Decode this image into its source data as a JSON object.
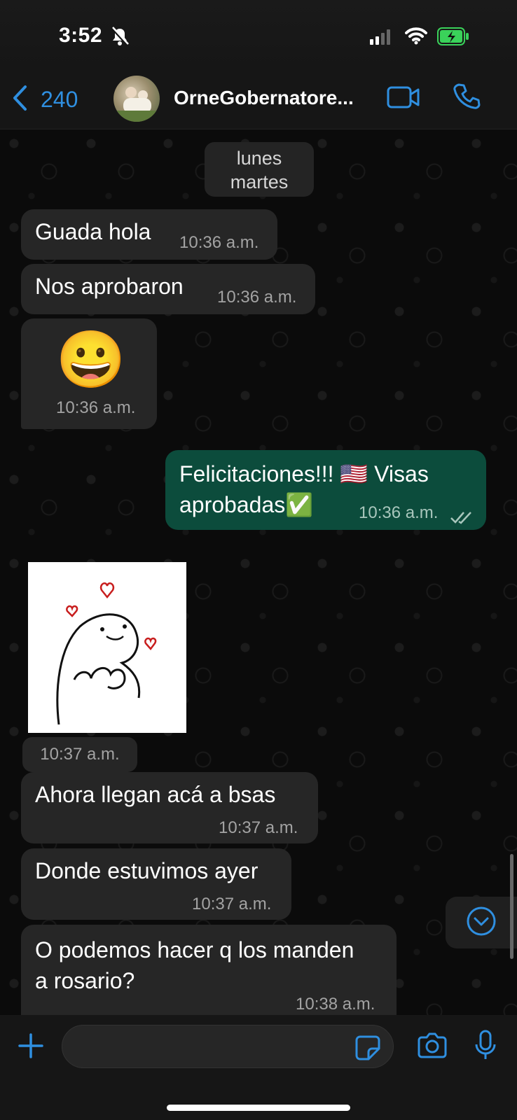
{
  "status_bar": {
    "time": "3:52"
  },
  "header": {
    "back_count": "240",
    "contact_name": "OrneGobernatore..."
  },
  "date_pill": {
    "line1": "lunes",
    "line2": "martes"
  },
  "messages": [
    {
      "text": "Guada hola",
      "time": "10:36 a.m."
    },
    {
      "text": "Nos aprobaron",
      "time": "10:36 a.m."
    },
    {
      "text": "😀",
      "time": "10:36 a.m."
    },
    {
      "text_line1": "Felicitaciones!!! 🇺🇸 Visas",
      "text_line2": "aprobadas✅",
      "time": "10:36 a.m."
    },
    {
      "time": "10:37 a.m."
    },
    {
      "text": "Ahora llegan acá a bsas",
      "time": "10:37 a.m."
    },
    {
      "text": "Donde estuvimos ayer",
      "time": "10:37 a.m."
    },
    {
      "text_line1": "O podemos hacer q los manden",
      "text_line2": "a rosario?",
      "time": "10:38 a.m."
    }
  ],
  "input": {
    "placeholder": ""
  },
  "icons": {
    "back": "chevron-left-icon",
    "video": "video-camera-icon",
    "call": "phone-icon",
    "scroll": "chevron-down-circle-icon",
    "plus": "plus-icon",
    "sticker": "sticker-icon",
    "camera": "camera-icon",
    "mic": "microphone-icon"
  },
  "colors": {
    "accent": "#2f8fe0",
    "outgoing_bubble": "#0c4c3c",
    "incoming_bubble": "#262626",
    "battery": "#3ad25a"
  }
}
